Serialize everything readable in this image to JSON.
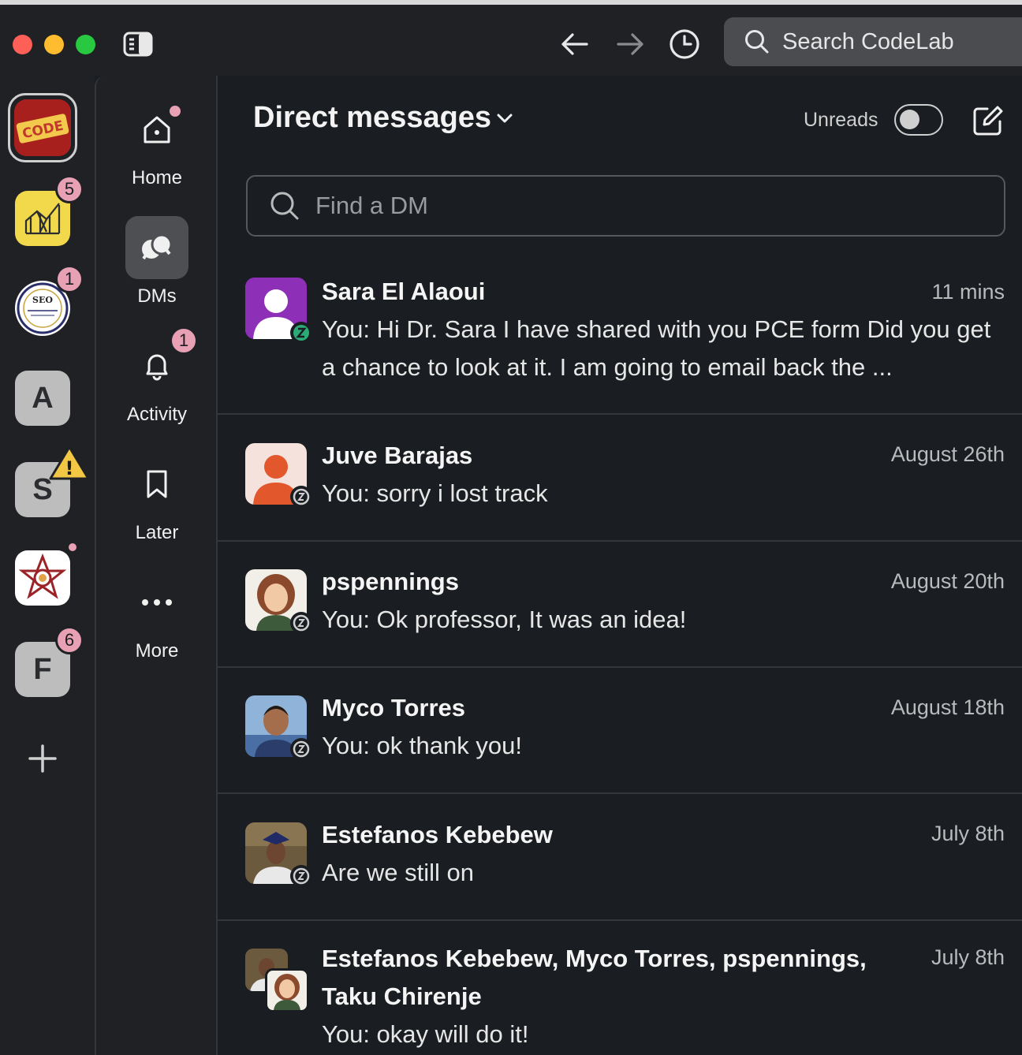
{
  "search": {
    "placeholder": "Search CodeLab"
  },
  "workspaces": [
    {
      "name": "CodeLab",
      "logo_text": "CODE"
    },
    {
      "name": "yellow-workspace",
      "badge": "5"
    },
    {
      "name": "SEO",
      "logo_text": "SEO",
      "badge": "1"
    },
    {
      "name": "A",
      "letter": "A"
    },
    {
      "name": "S",
      "letter": "S",
      "warning": "!"
    },
    {
      "name": "star-workspace"
    },
    {
      "name": "F",
      "letter": "F",
      "badge": "6"
    }
  ],
  "nav": {
    "home": "Home",
    "dms": "DMs",
    "activity": "Activity",
    "activity_badge": "1",
    "later": "Later",
    "more": "More"
  },
  "main": {
    "title": "Direct messages",
    "unreads_label": "Unreads",
    "find_placeholder": "Find a DM"
  },
  "dms": [
    {
      "name": "Sara El Alaoui",
      "time": "11 mins",
      "preview": "You: Hi Dr. Sara I have shared with you PCE form Did you get a chance to look at it. I am going to email back the ..."
    },
    {
      "name": "Juve Barajas",
      "time": "August 26th",
      "preview": "You: sorry i lost track"
    },
    {
      "name": "pspennings",
      "time": "August 20th",
      "preview": "You: Ok professor, It was an idea!"
    },
    {
      "name": "Myco Torres",
      "time": "August 18th",
      "preview": "You: ok thank you!"
    },
    {
      "name": "Estefanos Kebebew",
      "time": "July 8th",
      "preview": "Are we still on"
    },
    {
      "name_line1": "Estefanos Kebebew, Myco Torres, pspennings,",
      "name_line2": "Taku Chirenje",
      "time": "July 8th",
      "preview": "You: okay will do it!"
    }
  ],
  "colors": {
    "background": "#1a1d21",
    "badge": "#e8a1b4",
    "away_status": "#2bac76"
  }
}
